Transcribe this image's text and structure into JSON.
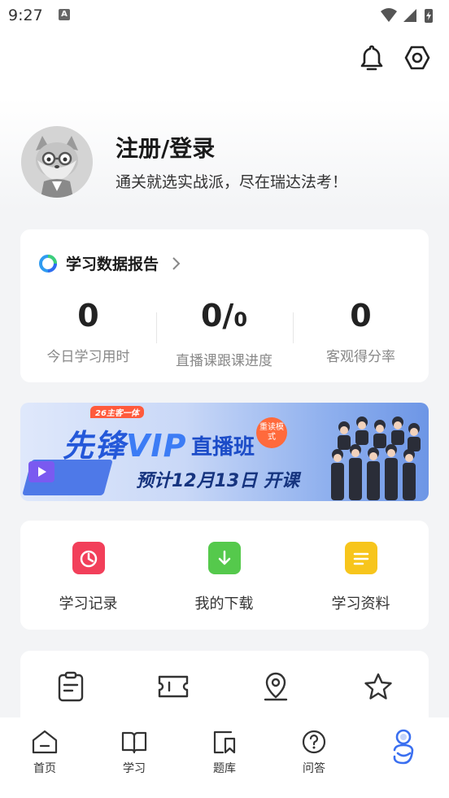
{
  "status_bar": {
    "time": "9:27",
    "notif_letter": "A"
  },
  "profile": {
    "name": "注册/登录",
    "slogan": "通关就选实战派，尽在瑞达法考！"
  },
  "report": {
    "title": "学习数据报告",
    "stats": [
      {
        "value": "0",
        "label": "今日学习用时"
      },
      {
        "value_main": "0/",
        "value_small": "0",
        "label": "直播课跟课进度"
      },
      {
        "value": "0",
        "label": "客观得分率"
      }
    ]
  },
  "banner": {
    "tag": "26主客一体",
    "title_prefix": "先锋",
    "title_vip": "VIP",
    "title_suffix": "直播班",
    "badge": "重读模式",
    "date": "预计12月13日 开课"
  },
  "tools": [
    {
      "label": "学习记录",
      "icon": "clock-icon",
      "color": "#f23f5a"
    },
    {
      "label": "我的下载",
      "icon": "download-icon",
      "color": "#55c94c"
    },
    {
      "label": "学习资料",
      "icon": "document-icon",
      "color": "#f7c51c"
    }
  ],
  "more_icons": [
    "clipboard-icon",
    "ticket-icon",
    "location-icon",
    "star-icon"
  ],
  "tabs": [
    {
      "label": "首页",
      "icon": "home-icon"
    },
    {
      "label": "学习",
      "icon": "book-icon"
    },
    {
      "label": "题库",
      "icon": "bookmark-icon"
    },
    {
      "label": "问答",
      "icon": "question-icon"
    },
    {
      "label": "",
      "icon": "profile-icon",
      "active": true
    }
  ],
  "colors": {
    "accent": "#2f6cf0",
    "tab_active": "#3a6ff0"
  }
}
